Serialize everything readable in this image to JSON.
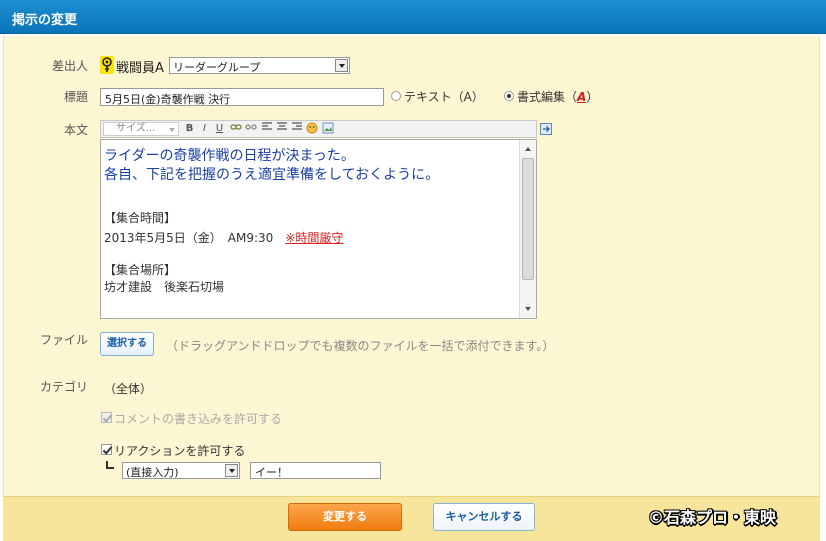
{
  "window": {
    "title": "掲示の変更"
  },
  "form": {
    "sender": {
      "label": "差出人",
      "name": "戦闘員A",
      "group": "リーダーグループ"
    },
    "subject": {
      "label": "標題",
      "value": "5月5日(金)奇襲作戦  決行",
      "format_text": "テキスト（A）",
      "format_rich": "書式編集（",
      "format_rich_key": "A",
      "format_rich_close": "）",
      "selected_format": "書式編集"
    },
    "body": {
      "label": "本文",
      "size_placeholder": "サイズ...",
      "toolbar_buttons": [
        "B",
        "I",
        "U",
        "link",
        "unlink",
        "align-left",
        "align-center",
        "align-right",
        "emoji",
        "image"
      ],
      "line1": "ライダーの奇襲作戦の日程が決まった。",
      "line2": "各自、下記を把握のうえ適宜準備をしておくように。",
      "time_heading": "【集合時間】",
      "time_value": "2013年5月5日（金）　AM9:30　",
      "time_warning": "※時間厳守",
      "place_heading": "【集合場所】",
      "place_value": "坊才建設　後楽石切場"
    },
    "file": {
      "label": "ファイル",
      "button": "選択する",
      "hint": "（ドラッグアンドドロップでも複数のファイルを一括で添付できます。）"
    },
    "category": {
      "label": "カテゴリ",
      "value": "（全体）"
    },
    "allow_comments": {
      "label": "コメントの書き込みを許可する",
      "checked": true,
      "disabled": true
    },
    "allow_reactions": {
      "label": "リアクションを許可する",
      "checked": true,
      "type": "(直接入力)",
      "text": "イー！"
    }
  },
  "footer": {
    "submit": "変更する",
    "cancel": "キャンセルする",
    "copyright": "©石森プロ・東映"
  },
  "colors": {
    "header": "#0b74b8",
    "panel": "#fdf6d3",
    "footer": "#f7e59c",
    "primary_button": "#f07c10",
    "body_lead_text": "#1a3fa6",
    "warning": "#e02020"
  }
}
